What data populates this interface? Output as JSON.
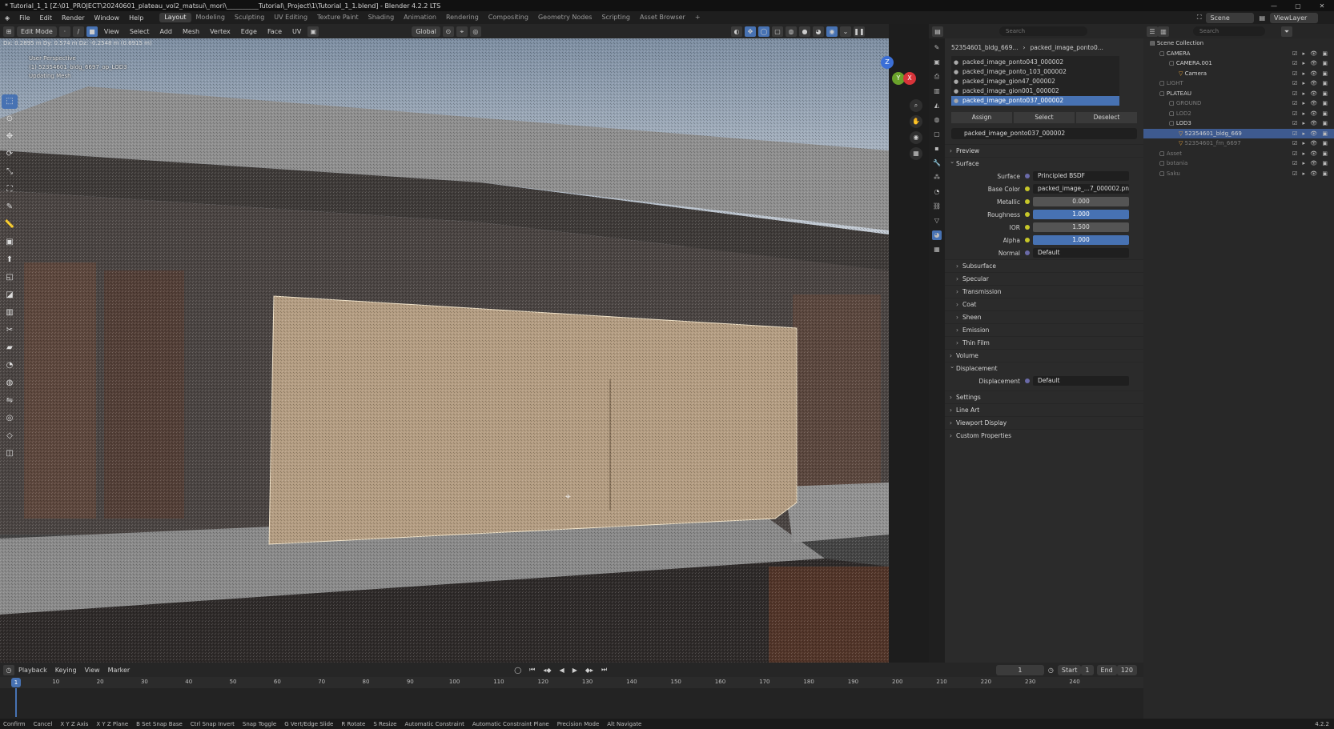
{
  "window": {
    "title": "* Tutorial_1_1 [Z:\\01_PROJECT\\20240601_plateau_vol2_matsui\\_mori\\__________Tutorial\\_Project\\1\\Tutorial_1_1.blend] - Blender 4.2.2 LTS",
    "controls": [
      "—",
      "▢",
      "✕"
    ]
  },
  "menu": {
    "items": [
      "File",
      "Edit",
      "Render",
      "Window",
      "Help"
    ],
    "workspaces": [
      "Layout",
      "Modeling",
      "Sculpting",
      "UV Editing",
      "Texture Paint",
      "Shading",
      "Animation",
      "Rendering",
      "Compositing",
      "Geometry Nodes",
      "Scripting",
      "Asset Browser"
    ],
    "active_workspace": "Layout",
    "add": "+",
    "scene_label": "Scene",
    "viewlayer_label": "ViewLayer"
  },
  "viewport_header": {
    "mode": "Edit Mode",
    "menus": [
      "View",
      "Select",
      "Add",
      "Mesh",
      "Vertex",
      "Edge",
      "Face",
      "UV"
    ],
    "orientation": "Global"
  },
  "viewport": {
    "status": "Dx: 0.2895 m  Dy: 0.574 m  Dz: -0.2548 m (0.6915 m)",
    "info_lines": [
      "User Perspective",
      "(1) 52354601_bldg_6697_op_LOD3",
      "Updating Mesh"
    ],
    "gizmo_axes": [
      "Z",
      "Y",
      "X"
    ],
    "colors": {
      "sky": "#aab6c2",
      "roof": "#8a8a8a",
      "wall": "#4a4644",
      "panel": "#b49d82",
      "ledge": "#8e8e8e",
      "lower": "#3a3634",
      "wood": "#6b4a3a"
    }
  },
  "toolbar_tools": [
    "select-box",
    "cursor",
    "move",
    "rotate",
    "scale",
    "transform",
    "annotate",
    "measure",
    "add-cube",
    "extrude",
    "inset",
    "bevel",
    "loop-cut",
    "knife",
    "poly-build",
    "spin",
    "smooth",
    "edge-slide",
    "shrink-fatten",
    "shear",
    "rip"
  ],
  "properties": {
    "search_placeholder": "Search",
    "breadcrumb": [
      "52354601_bldg_669...",
      "packed_image_ponto0..."
    ],
    "slots": [
      "packed_image_ponto043_000002",
      "packed_image_ponto_103_000002",
      "packed_image_gion47_000002",
      "packed_image_gion001_000002",
      "packed_image_ponto037_000002"
    ],
    "selected_slot": 4,
    "buttons": [
      "Assign",
      "Select",
      "Deselect"
    ],
    "material_name": "packed_image_ponto037_000002",
    "sections_top": [
      "Preview"
    ],
    "surface_title": "Surface",
    "surface_rows": [
      {
        "label": "Surface",
        "value": "Principled BSDF",
        "style": "dark",
        "dot": "g"
      },
      {
        "label": "Base Color",
        "value": "packed_image_...7_000002.png",
        "style": "dark",
        "dot": "y"
      },
      {
        "label": "Metallic",
        "value": "0.000",
        "style": "num",
        "dot": "y"
      },
      {
        "label": "Roughness",
        "value": "1.000",
        "style": "bar",
        "dot": "y"
      },
      {
        "label": "IOR",
        "value": "1.500",
        "style": "num",
        "dot": "y"
      },
      {
        "label": "Alpha",
        "value": "1.000",
        "style": "bar",
        "dot": "y"
      },
      {
        "label": "Normal",
        "value": "Default",
        "style": "dark",
        "dot": "g"
      }
    ],
    "subsections": [
      "Subsurface",
      "Specular",
      "Transmission",
      "Coat",
      "Sheen",
      "Emission",
      "Thin Film"
    ],
    "volume": "Volume",
    "displacement_title": "Displacement",
    "displacement_row": {
      "label": "Displacement",
      "value": "Default"
    },
    "sections_bottom": [
      "Settings",
      "Line Art",
      "Viewport Display",
      "Custom Properties"
    ]
  },
  "outliner": {
    "search_placeholder": "Search",
    "rows": [
      {
        "label": "Scene Collection",
        "indent": 0,
        "sel": false,
        "dim": false
      },
      {
        "label": "CAMERA",
        "indent": 1,
        "sel": false,
        "dim": false
      },
      {
        "label": "CAMERA.001",
        "indent": 2,
        "sel": false,
        "dim": false
      },
      {
        "label": "Camera",
        "indent": 3,
        "sel": false,
        "dim": false
      },
      {
        "label": "LIGHT",
        "indent": 1,
        "sel": false,
        "dim": true
      },
      {
        "label": "PLATEAU",
        "indent": 1,
        "sel": false,
        "dim": false
      },
      {
        "label": "GROUND",
        "indent": 2,
        "sel": false,
        "dim": true
      },
      {
        "label": "LOD2",
        "indent": 2,
        "sel": false,
        "dim": true
      },
      {
        "label": "LOD3",
        "indent": 2,
        "sel": false,
        "dim": false
      },
      {
        "label": "52354601_bldg_669",
        "indent": 3,
        "sel": true,
        "dim": false
      },
      {
        "label": "52354601_frn_6697",
        "indent": 3,
        "sel": false,
        "dim": true
      },
      {
        "label": "Asset",
        "indent": 1,
        "sel": false,
        "dim": true
      },
      {
        "label": "botania",
        "indent": 1,
        "sel": false,
        "dim": true
      },
      {
        "label": "Saku",
        "indent": 1,
        "sel": false,
        "dim": true
      }
    ]
  },
  "timeline": {
    "menus": [
      "Playback",
      "Keying",
      "View",
      "Marker"
    ],
    "current_frame": "1",
    "start_label": "Start",
    "start": "1",
    "end_label": "End",
    "end": "120",
    "ticks": [
      1,
      10,
      20,
      30,
      40,
      50,
      60,
      70,
      80,
      90,
      100,
      110,
      120,
      130,
      140,
      150,
      160,
      170,
      180,
      190,
      200,
      210,
      220,
      230,
      240
    ]
  },
  "statusbar": {
    "items": [
      "Confirm",
      "Cancel",
      "X Y Z Axis",
      "X Y Z Plane",
      "B Set Snap Base",
      "Ctrl Snap Invert",
      "Snap Toggle",
      "G Vert/Edge Slide",
      "R Rotate",
      "S Resize",
      "Automatic Constraint",
      "Automatic Constraint Plane",
      "Precision Mode",
      "Alt Navigate"
    ],
    "version": "4.2.2"
  }
}
